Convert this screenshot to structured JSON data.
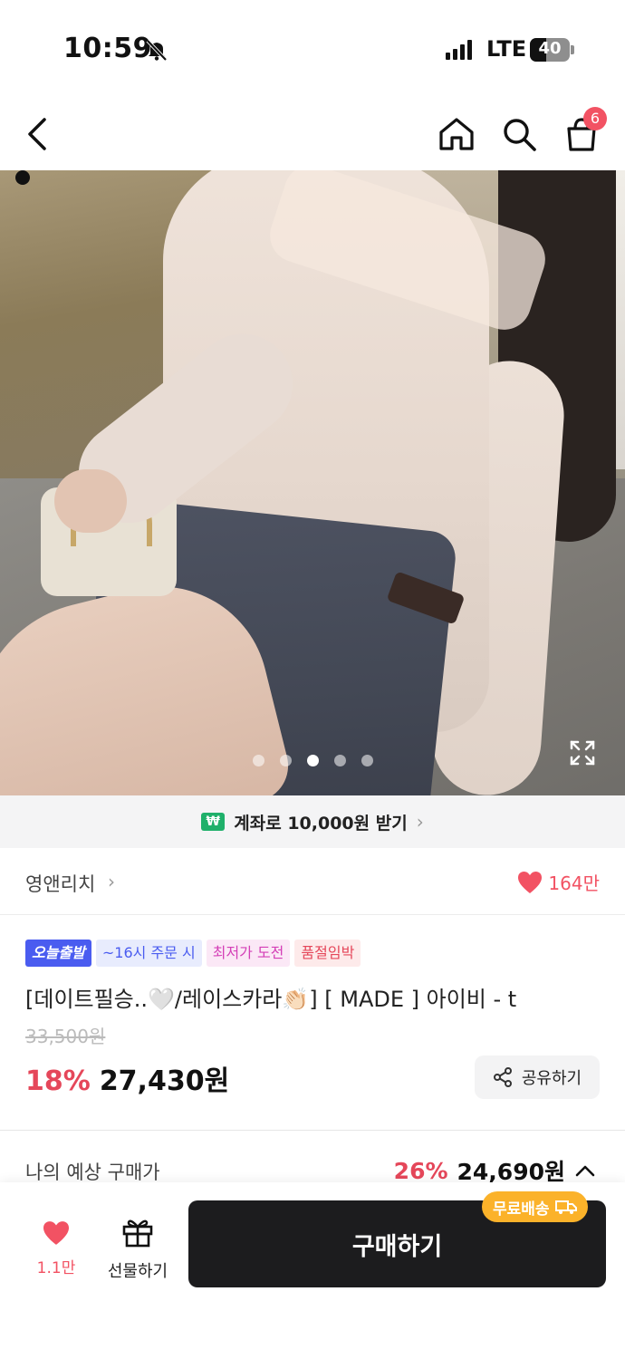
{
  "status_bar": {
    "time": "10:59",
    "network": "LTE",
    "battery": "40",
    "battery_level": 0.4
  },
  "nav": {
    "cart_count": "6"
  },
  "gallery": {
    "current_page": 3,
    "total_pages": 5
  },
  "banner": {
    "text": "계좌로 10,000원 받기",
    "icon_label": "₩"
  },
  "store": {
    "name": "영앤리치",
    "likes": "164만"
  },
  "badges": {
    "today": "오늘출발",
    "cutoff": "~16시 주문 시",
    "lowest": "최저가 도전",
    "soldout": "품절임박"
  },
  "product": {
    "title": "[데이트필승..🤍/레이스카라👏🏻] [ MADE ] 아이비 - t",
    "original_price": "33,500원",
    "discount": "18%",
    "price": "27,430원",
    "share_label": "공유하기"
  },
  "expected": {
    "label": "나의 예상 구매가",
    "discount": "26%",
    "price": "24,690원"
  },
  "bottom": {
    "like_count": "1.1만",
    "gift_label": "선물하기",
    "buy_label": "구매하기",
    "free_shipping": "무료배송"
  },
  "colors": {
    "accent_red": "#f25263",
    "discount_red": "#e5475a",
    "today_blue": "#4a5cf0",
    "free_ship_orange": "#fbb22a",
    "buy_button": "#1c1c1e"
  }
}
